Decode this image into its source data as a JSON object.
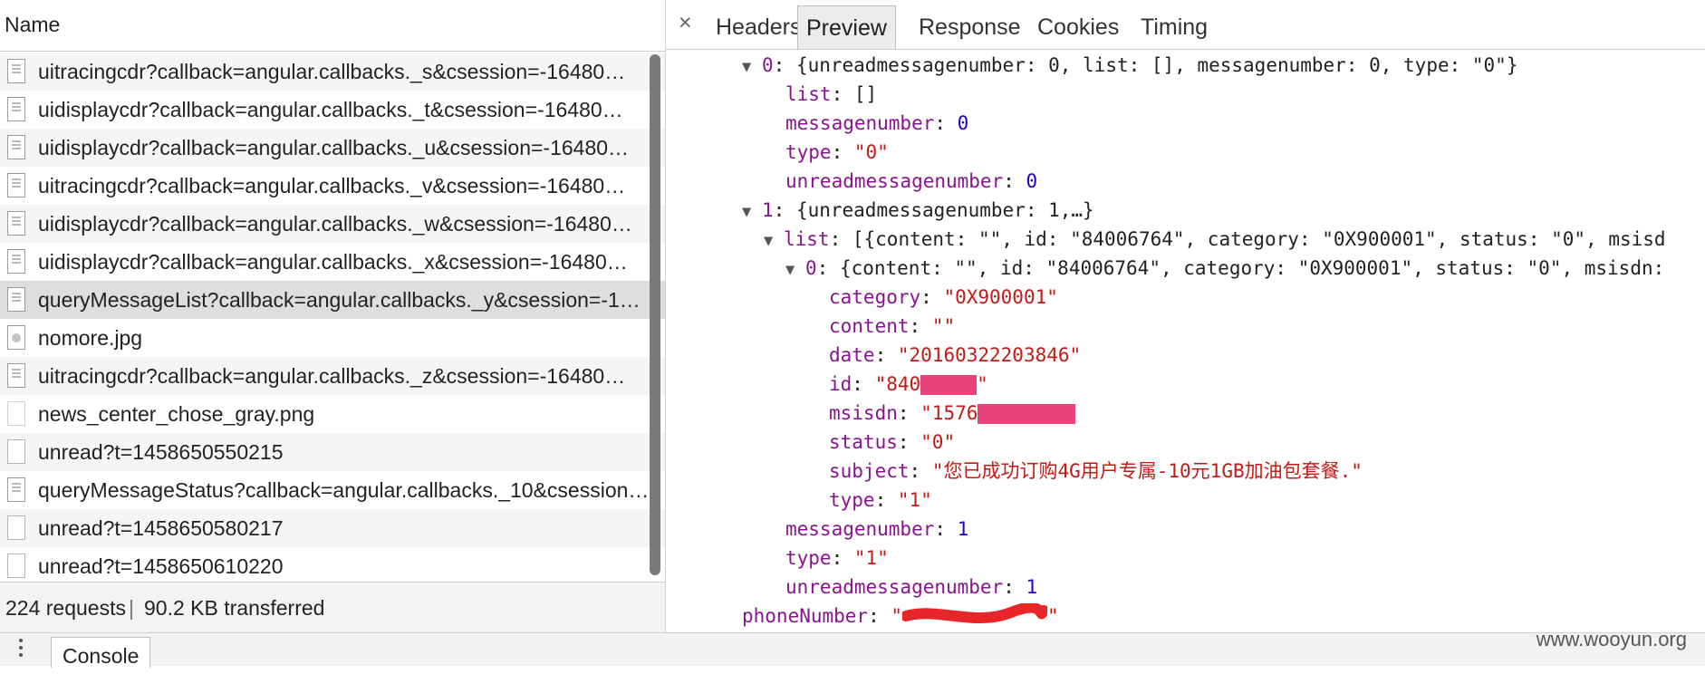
{
  "network": {
    "column_name": "Name",
    "requests": [
      {
        "name": "uitracingcdr?callback=angular.callbacks._s&csession=-16480…",
        "icon": "doc"
      },
      {
        "name": "uidisplaycdr?callback=angular.callbacks._t&csession=-16480…",
        "icon": "doc"
      },
      {
        "name": "uidisplaycdr?callback=angular.callbacks._u&csession=-16480…",
        "icon": "doc"
      },
      {
        "name": "uitracingcdr?callback=angular.callbacks._v&csession=-16480…",
        "icon": "doc"
      },
      {
        "name": "uidisplaycdr?callback=angular.callbacks._w&csession=-16480…",
        "icon": "doc"
      },
      {
        "name": "uidisplaycdr?callback=angular.callbacks._x&csession=-16480…",
        "icon": "doc"
      },
      {
        "name": "queryMessageList?callback=angular.callbacks._y&csession=-1…",
        "icon": "doc",
        "selected": true
      },
      {
        "name": "nomore.jpg",
        "icon": "img"
      },
      {
        "name": "uitracingcdr?callback=angular.callbacks._z&csession=-16480…",
        "icon": "doc"
      },
      {
        "name": "news_center_chose_gray.png",
        "icon": "png"
      },
      {
        "name": "unread?t=1458650550215",
        "icon": "blank"
      },
      {
        "name": "queryMessageStatus?callback=angular.callbacks._10&csession…",
        "icon": "doc"
      },
      {
        "name": "unread?t=1458650580217",
        "icon": "blank"
      },
      {
        "name": "unread?t=1458650610220",
        "icon": "blank"
      }
    ],
    "requests_count": "224 requests",
    "separator": "|",
    "transferred": "90.2 KB transferred"
  },
  "tabs": {
    "close": "×",
    "items": [
      "Headers",
      "Preview",
      "Response",
      "Cookies",
      "Timing"
    ],
    "active": "Preview"
  },
  "preview": {
    "item0_summary": "{unreadmessagenumber: 0, list: [], messagenumber: 0, type: \"0\"}",
    "item0_index": "0",
    "item0_list": "[]",
    "item0_messagenumber": "0",
    "item0_type": "\"0\"",
    "item0_unread": "0",
    "item1_index": "1",
    "item1_summary": "{unreadmessagenumber: 1,…}",
    "list_summary": "[{content: \"\", id: \"84006764\", category: \"0X900001\", status: \"0\", msisd",
    "msg0_summary": "{content: \"\", id: \"84006764\", category: \"0X900001\", status: \"0\", msisdn:",
    "msg0_index": "0",
    "category": "\"0X900001\"",
    "content": "\"\"",
    "date": "\"20160322203846\"",
    "id_visible": "\"840",
    "id_tail": "\"",
    "msisdn_visible": "\"1576",
    "status": "\"0\"",
    "subject": "\"您已成功订购4G用户专属-10元1GB加油包套餐.\"",
    "msg_type": "\"1\"",
    "item1_messagenumber": "1",
    "item1_type": "\"1\"",
    "item1_unread": "1",
    "phone_key": "phoneNumber",
    "keys": {
      "list": "list",
      "messagenumber": "messagenumber",
      "type": "type",
      "unreadmessagenumber": "unreadmessagenumber",
      "category": "category",
      "content": "content",
      "date": "date",
      "id": "id",
      "msisdn": "msisdn",
      "status": "status",
      "subject": "subject"
    }
  },
  "drawer": {
    "console_label": "Console"
  },
  "watermark": "www.wooyun.org",
  "colors": {
    "key": "#881391",
    "string": "#c41a16",
    "number": "#1c00cf",
    "redaction": "#e8427a"
  }
}
